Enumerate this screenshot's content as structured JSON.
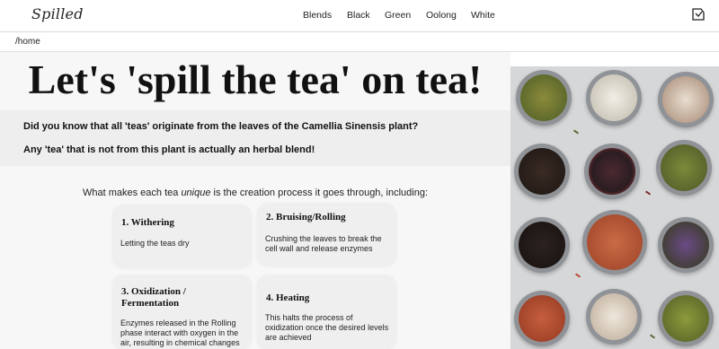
{
  "header": {
    "logo": "Spilled",
    "nav": [
      "Blends",
      "Black",
      "Green",
      "Oolong",
      "White"
    ],
    "cart_icon": "shopping-bag-icon"
  },
  "breadcrumb": "/home",
  "hero": {
    "title": "Let's 'spill the tea' on tea!"
  },
  "facts": [
    "Did you know that all 'teas' originate from the leaves of the Camellia Sinensis plant?",
    "Any 'tea' that is not from this plant is actually an herbal blend!"
  ],
  "intro": {
    "before": "What makes each tea ",
    "emphasis": "unique",
    "after": " is the creation process it goes through, including:"
  },
  "steps": [
    {
      "title": "1. Withering",
      "desc": "Letting the teas dry"
    },
    {
      "title": "2. Bruising/Rolling",
      "desc": "Crushing the leaves to break the cell wall and release enzymes"
    },
    {
      "title": "3. Oxidization / Fermentation",
      "desc": "Enzymes released in the Rolling phase interact with oxygen in the air, resulting in chemical changes"
    },
    {
      "title": "4. Heating",
      "desc": "This halts the process of oxidization once the desired levels are achieved"
    }
  ],
  "colors": {
    "page_bg": "#f7f7f7",
    "fact_band": "#eeeeee",
    "card_bg": "#efefef"
  }
}
